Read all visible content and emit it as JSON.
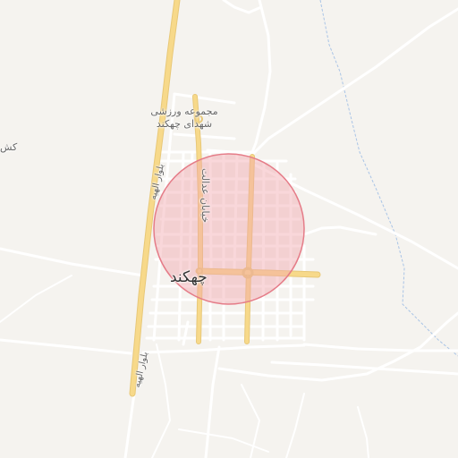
{
  "map": {
    "labels": {
      "sports_complex_line1": "مجموعه ورزشی",
      "sports_complex_line2": "شهدای چهکند",
      "town": "چهکند",
      "street": "خیابان عدالت",
      "boulevard_north": "بلوار الهیه",
      "boulevard_south": "بلوار الهیه",
      "edge_fragment": "کش"
    },
    "colors": {
      "background": "#f5f3ef",
      "minor_road": "#ffffff",
      "main_road": "#f7d98a",
      "main_road_edge": "#e8c878",
      "waterway": "#a9c4e6",
      "highlight_fill": "#f2a7ae",
      "highlight_stroke": "#e57c88"
    },
    "highlight": {
      "shape": "circle"
    }
  }
}
